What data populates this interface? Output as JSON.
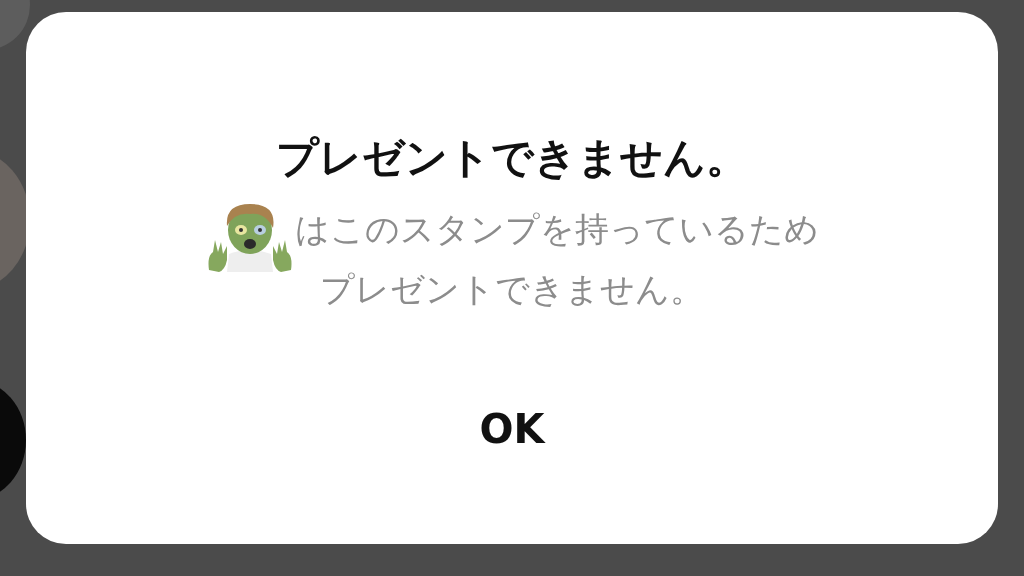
{
  "alert": {
    "title": "プレゼントできません。",
    "message_lines": [
      "はこのスタンプを持っているため",
      "プレゼントできません。"
    ],
    "button": "OK"
  }
}
